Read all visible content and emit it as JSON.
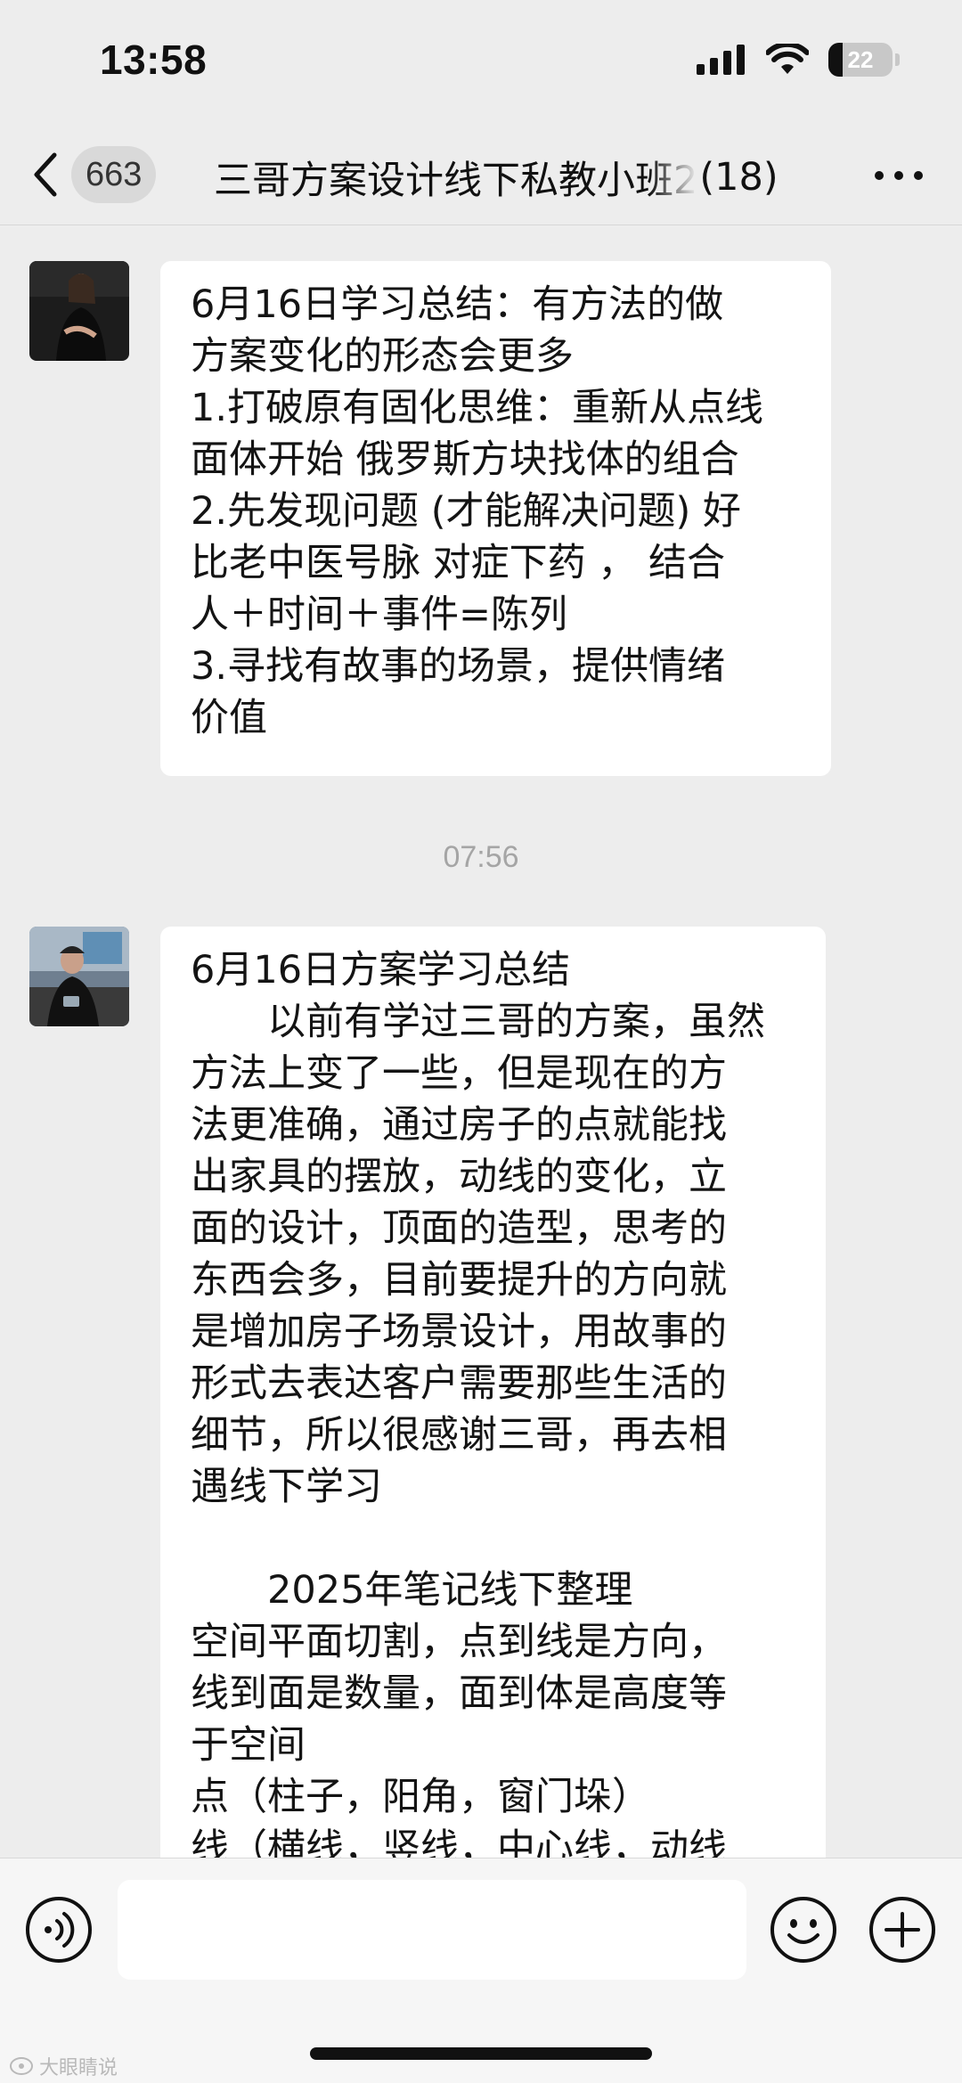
{
  "status_bar": {
    "time": "13:58",
    "battery_level": "22",
    "icons": [
      "signal-icon",
      "wifi-icon",
      "battery-icon"
    ]
  },
  "nav": {
    "back_count": "663",
    "title": "三哥方案设计线下私教小班2",
    "member_count": "(18)",
    "icons": [
      "back-chevron-icon",
      "more-icon"
    ]
  },
  "messages": [
    {
      "lines": [
        "6月16日学习总结：有方法的做",
        "方案变化的形态会更多",
        "1.打破原有固化思维：重新从点线",
        "面体开始 俄罗斯方块找体的组合",
        "2.先发现问题 (才能解决问题) 好",
        "比老中医号脉 对症下药 ， 结合",
        "人＋时间＋事件=陈列",
        "3.寻找有故事的场景，提供情绪",
        "价值"
      ]
    },
    {
      "lines": [
        "6月16日方案学习总结",
        "　　以前有学过三哥的方案，虽然",
        "方法上变了一些，但是现在的方",
        "法更准确，通过房子的点就能找",
        "出家具的摆放，动线的变化，立",
        "面的设计，顶面的造型，思考的",
        "东西会多，目前要提升的方向就",
        "是增加房子场景设计，用故事的",
        "形式去表达客户需要那些生活的",
        "细节，所以很感谢三哥，再去相",
        "遇线下学习",
        " ",
        "　　2025年笔记线下整理",
        "空间平面切割，点到线是方向，",
        "线到面是数量，面到体是高度等",
        "于空间",
        "点（柱子，阳角，窗门垛）",
        "线（横线，竖线，中心线，动线"
      ]
    }
  ],
  "timestamp": "07:56",
  "input_bar": {
    "placeholder": "",
    "icons": [
      "voice-icon",
      "emoji-icon",
      "plus-icon"
    ]
  },
  "watermark": "大眼睛说"
}
